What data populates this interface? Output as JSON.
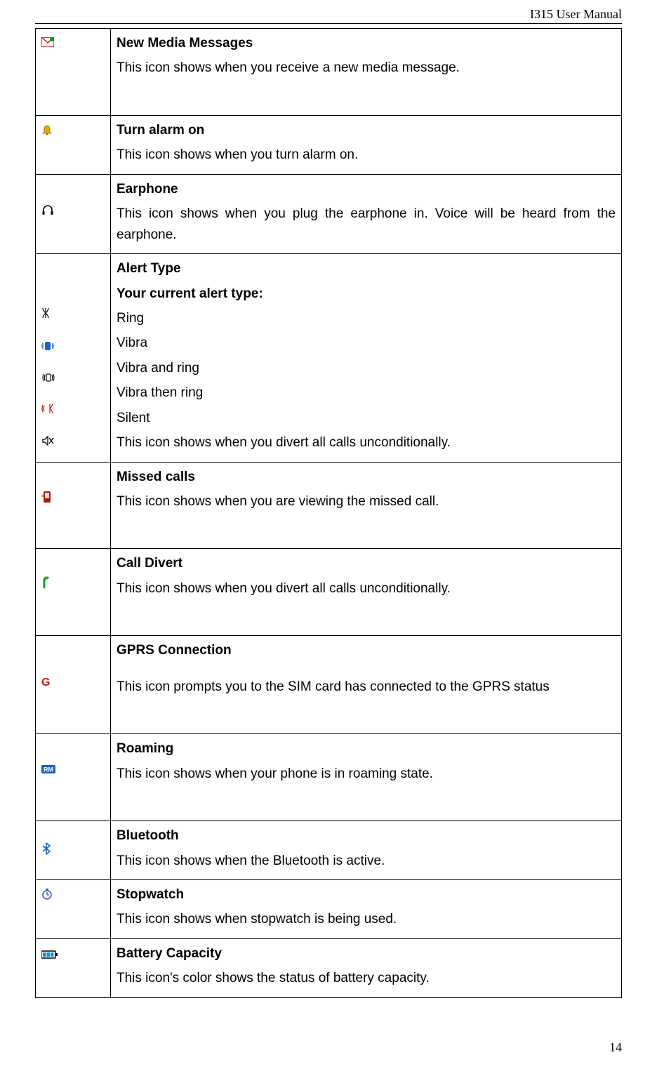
{
  "header": "I315 User Manual",
  "page_number": "14",
  "rows": {
    "new_media": {
      "title": "New Media Messages",
      "desc": "This icon shows when you receive a new media message."
    },
    "alarm": {
      "title": "Turn alarm on",
      "desc": "This icon shows when you turn alarm on."
    },
    "earphone": {
      "title": "Earphone",
      "desc": "This icon shows when you plug the earphone in. Voice will be heard from the earphone."
    },
    "alert": {
      "title": "Alert Type",
      "subtitle": "Your current alert type:",
      "ring": "Ring",
      "vibra": "Vibra",
      "vibra_ring": "Vibra and ring",
      "vibra_then": "Vibra then ring",
      "silent": "Silent",
      "footer": "This icon shows when you divert all calls unconditionally."
    },
    "missed": {
      "title": "Missed calls",
      "desc": "This icon shows when you are viewing the missed call."
    },
    "divert": {
      "title": "Call Divert",
      "desc": "This icon shows when you divert all calls unconditionally."
    },
    "gprs": {
      "title": "GPRS Connection",
      "desc": "This icon prompts you to the SIM card has connected to the GPRS status"
    },
    "roaming": {
      "title": "Roaming",
      "desc": "This icon shows when your phone is in roaming state."
    },
    "bluetooth": {
      "title": "Bluetooth",
      "desc": "This icon shows when the Bluetooth is active."
    },
    "stopwatch": {
      "title": "Stopwatch",
      "desc": "This icon shows when stopwatch is being used."
    },
    "battery": {
      "title": "Battery Capacity",
      "desc": "This icon's color shows the status of battery capacity."
    }
  }
}
